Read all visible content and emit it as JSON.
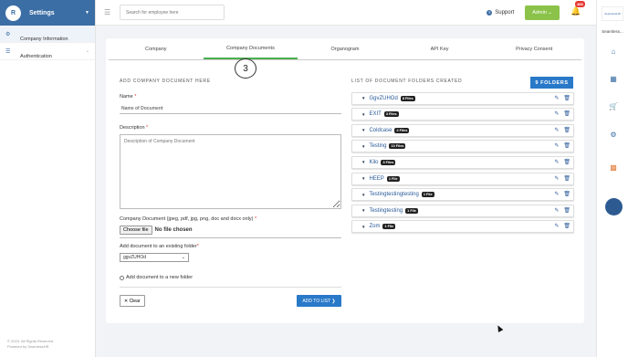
{
  "sidebar": {
    "logo": "R",
    "title": "Settings",
    "items": [
      {
        "label": "Company Information",
        "icon": "gear-icon"
      },
      {
        "label": "Authentication",
        "icon": "list-icon"
      }
    ],
    "footer_line1": "© 2023. All Rights Reserved.",
    "footer_line2": "Powered by SeamlessHR"
  },
  "topbar": {
    "search_placeholder": "Search for employee here",
    "support_label": "Support",
    "admin_label": "Admin ⌄",
    "notification_count": "488"
  },
  "rail": {
    "logo_text": "SeamlessHR",
    "title": "Seamless..."
  },
  "tabs": [
    {
      "label": "Company"
    },
    {
      "label": "Company Documents",
      "active": true
    },
    {
      "label": "Organogram"
    },
    {
      "label": "API Key"
    },
    {
      "label": "Privacy Consent"
    }
  ],
  "step_marker": "3",
  "form": {
    "section_title": "ADD COMPANY DOCUMENT HERE",
    "name_label": "Name ",
    "name_placeholder": "Name of Document",
    "description_label": "Description ",
    "description_placeholder": "Description of Company Document",
    "file_label": "Company Document (jpeg, pdf, jpg, png, doc and docx only) ",
    "choose_file_label": "Choose file",
    "no_file_text": "No file chosen",
    "existing_folder_label": "Add document to an existing folder",
    "existing_folder_value": "ggvZUHOd",
    "new_folder_label": "Add document to a new folder",
    "clear_label": "✕ Clear",
    "add_label": "ADD TO LIST  ❯",
    "required_mark": "*"
  },
  "list": {
    "section_title": "LIST OF DOCUMENT FOLDERS CREATED",
    "folders_button": "9 FOLDERS",
    "folders": [
      {
        "name": "GgvZUHOd",
        "count": "8 Files"
      },
      {
        "name": "EXIT",
        "count": "3 Files"
      },
      {
        "name": "Coldcase",
        "count": "2 Files"
      },
      {
        "name": "Testing",
        "count": "10 Files"
      },
      {
        "name": "Kilo",
        "count": "3 Files"
      },
      {
        "name": "HEEP",
        "count": "1 File"
      },
      {
        "name": "Testingtestingtesting",
        "count": "1 File"
      },
      {
        "name": "Testingtesting",
        "count": "1 File"
      },
      {
        "name": "Zom",
        "count": "1 File"
      }
    ]
  },
  "colors": {
    "brand": "#3b6ea5",
    "primary_button": "#2979c9",
    "admin_button": "#8bc34a",
    "active_tab": "#4caf50",
    "notification": "#e53935"
  }
}
